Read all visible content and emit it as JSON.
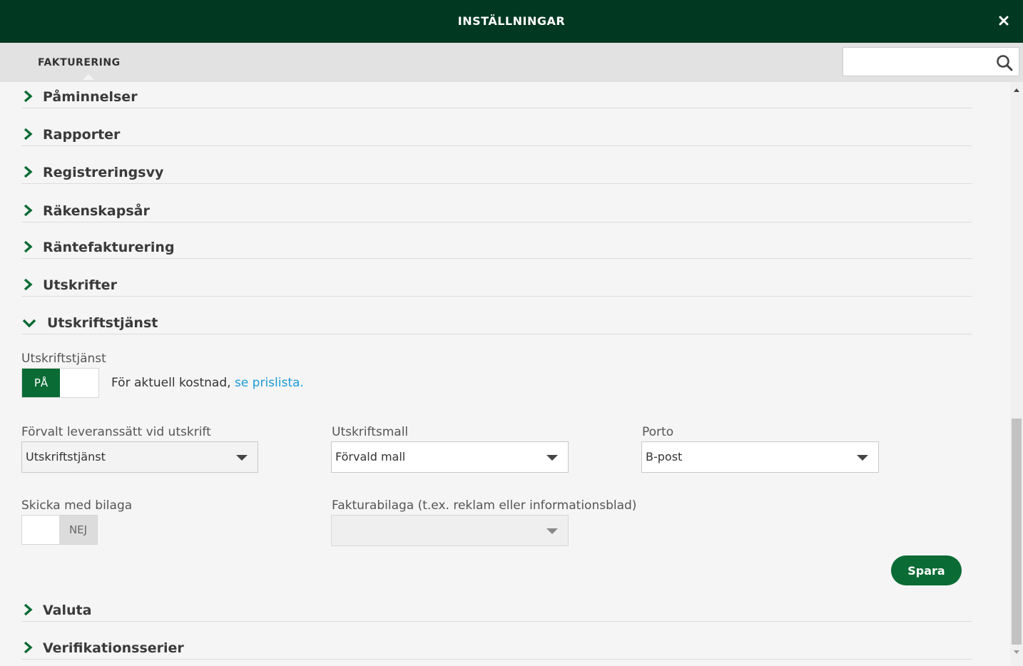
{
  "header": {
    "title": "INSTÄLLNINGAR",
    "close_icon": "close-icon"
  },
  "tabs": [
    {
      "label": "FAKTURERING",
      "active": true
    }
  ],
  "search": {
    "placeholder": "",
    "value": ""
  },
  "sections_top": [
    {
      "label": "Påminnelser"
    },
    {
      "label": "Rapporter"
    },
    {
      "label": "Registreringsvy"
    },
    {
      "label": "Räkenskapsår"
    },
    {
      "label": "Räntefakturering"
    },
    {
      "label": "Utskrifter"
    }
  ],
  "open_section": {
    "label": "Utskriftstjänst",
    "service": {
      "label": "Utskriftstjänst",
      "toggle_on_label": "PÅ",
      "note_text": "För aktuell kostnad, ",
      "note_link": "se prislista."
    },
    "delivery": {
      "label": "Förvalt leveranssätt vid utskrift",
      "value": "Utskriftstjänst"
    },
    "template": {
      "label": "Utskriftsmall",
      "value": "Förvald mall"
    },
    "porto": {
      "label": "Porto",
      "value": "B-post"
    },
    "attachment": {
      "label": "Skicka med bilaga",
      "toggle_off_label": "NEJ"
    },
    "invoice_attachment": {
      "label": "Fakturabilaga (t.ex. reklam eller informationsblad)",
      "value": ""
    },
    "save_label": "Spara"
  },
  "sections_bottom": [
    {
      "label": "Valuta"
    },
    {
      "label": "Verifikationsserier"
    }
  ],
  "colors": {
    "header_bg": "#003822",
    "accent": "#0a6b34",
    "link": "#1a9bd7"
  }
}
